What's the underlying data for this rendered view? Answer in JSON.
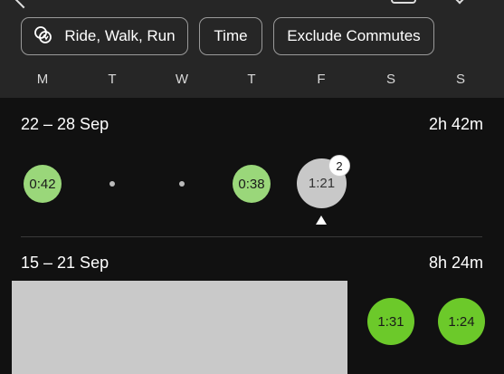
{
  "filters": {
    "sport_label": "Ride, Walk, Run",
    "time_label": "Time",
    "commute_label": "Exclude Commutes"
  },
  "weekdays": [
    "M",
    "T",
    "W",
    "T",
    "F",
    "S",
    "S"
  ],
  "weeks": [
    {
      "range": "22 – 28 Sep",
      "total": "2h 42m",
      "days": [
        {
          "day": "M",
          "value": "0:42"
        },
        {
          "day": "T",
          "value": ""
        },
        {
          "day": "W",
          "value": ""
        },
        {
          "day": "T",
          "value": "0:38"
        },
        {
          "day": "F",
          "value": "1:21",
          "badge": "2",
          "selected": true
        }
      ]
    },
    {
      "range": "15 – 21 Sep",
      "total": "8h 24m",
      "days": [
        {
          "day": "S",
          "value": "1:31"
        },
        {
          "day": "S",
          "value": "1:24"
        }
      ]
    }
  ],
  "colors": {
    "background": "#111111",
    "header": "#262626",
    "light_green": "#9ad77a",
    "strong_green": "#6cc92a",
    "selected_grey": "#c8c8c8"
  }
}
